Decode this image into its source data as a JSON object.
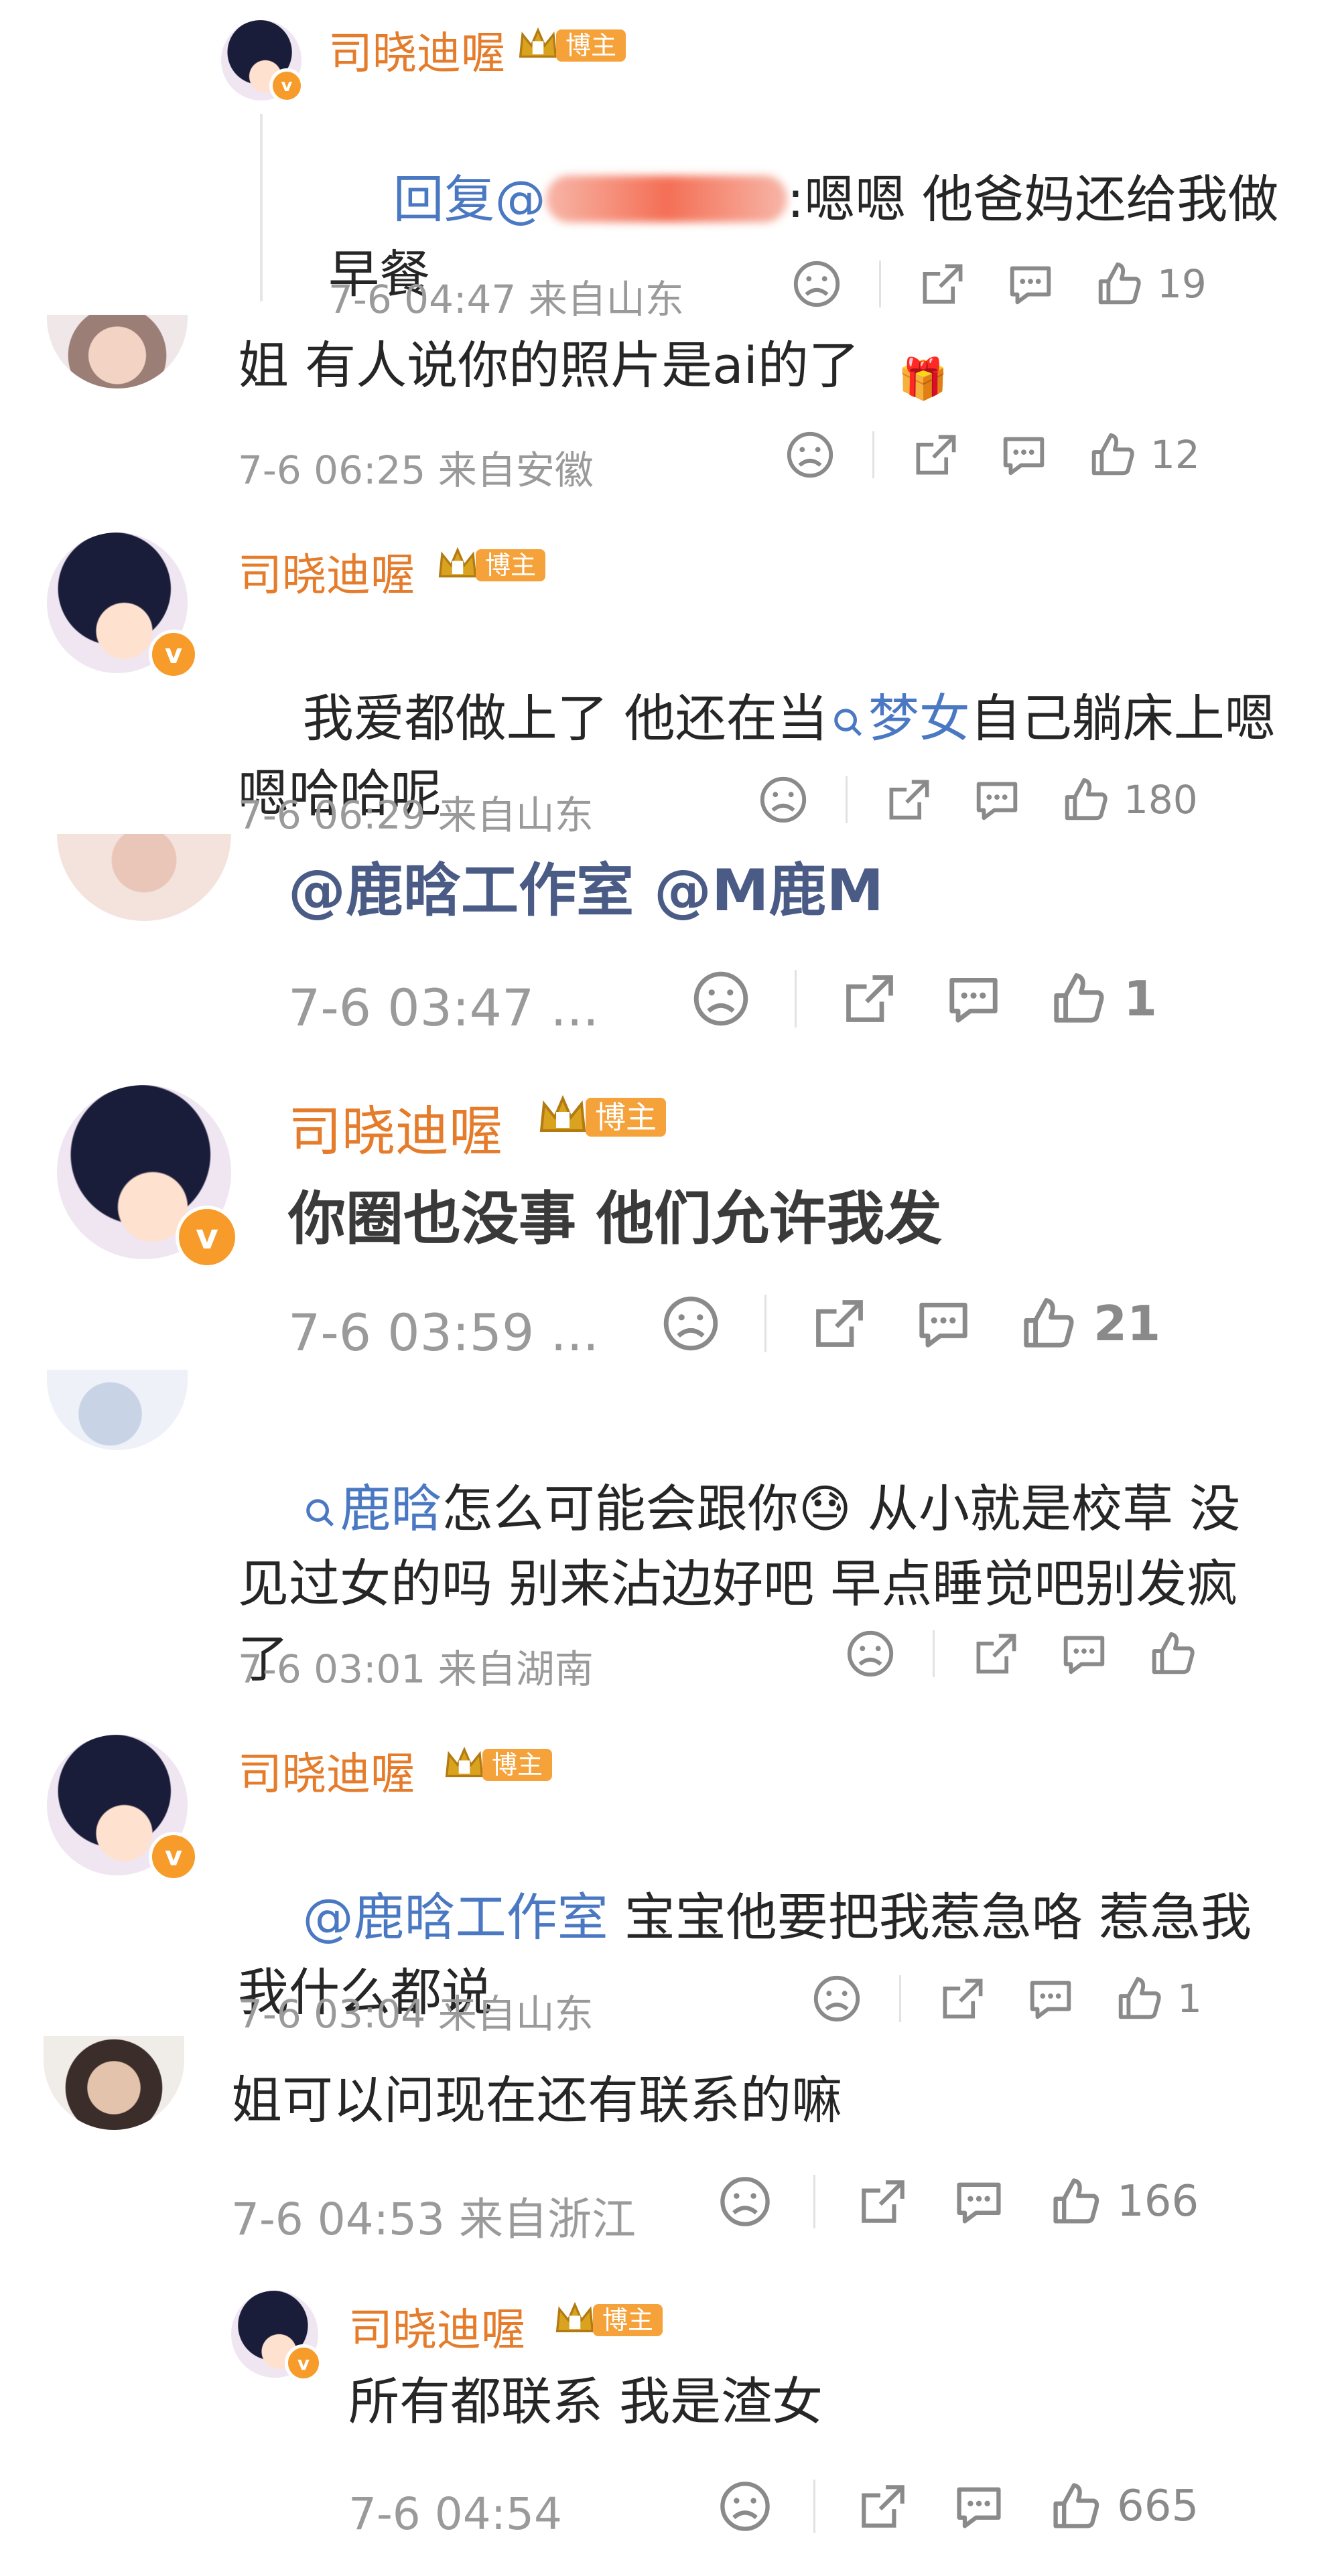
{
  "blogger_badge": "博主",
  "comments": [
    {
      "name": "司晓迪喔",
      "reply_prefix": "回复@",
      "text_after": ":嗯嗯 他爸妈还给我做早餐",
      "meta": "7-6 04:47 来自山东",
      "likes": "19"
    },
    {
      "text": "姐 有人说你的照片是ai的了",
      "meta": "7-6 06:25 来自安徽",
      "likes": "12"
    },
    {
      "name": "司晓迪喔",
      "text_a": "我爱都做上了 他还在当",
      "link": "梦女",
      "text_b": "自己躺床上嗯嗯哈哈呢",
      "meta": "7-6 06:29 来自山东",
      "likes": "180"
    },
    {
      "text": "@鹿晗工作室 @M鹿M",
      "meta": "7-6 03:47 ...",
      "likes": "1"
    },
    {
      "name": "司晓迪喔",
      "text": "你圈也没事 他们允许我发",
      "meta": "7-6 03:59 ...",
      "likes": "21"
    },
    {
      "link": "鹿晗",
      "text_a": "怎么可能会跟你",
      "text_b": " 从小就是校草 没见过女的吗 别来沾边好吧 早点睡觉吧别发疯了",
      "meta": "7-6 03:01 来自湖南",
      "likes": ""
    },
    {
      "name": "司晓迪喔",
      "link": "@鹿晗工作室",
      "text": " 宝宝他要把我惹急咯 惹急我我什么都说",
      "meta": "7-6 03:04 来自山东",
      "likes": "1"
    },
    {
      "text": "姐可以问现在还有联系的嘛",
      "meta": "7-6 04:53 来自浙江",
      "likes": "166"
    },
    {
      "name": "司晓迪喔",
      "text": "所有都联系 我是渣女",
      "meta": "7-6 04:54",
      "likes": "665"
    }
  ],
  "icons": [
    "sad-face-icon",
    "share-icon",
    "comment-icon",
    "thumbs-up-icon",
    "verified-badge-icon",
    "crown-icon",
    "search-link-icon"
  ]
}
